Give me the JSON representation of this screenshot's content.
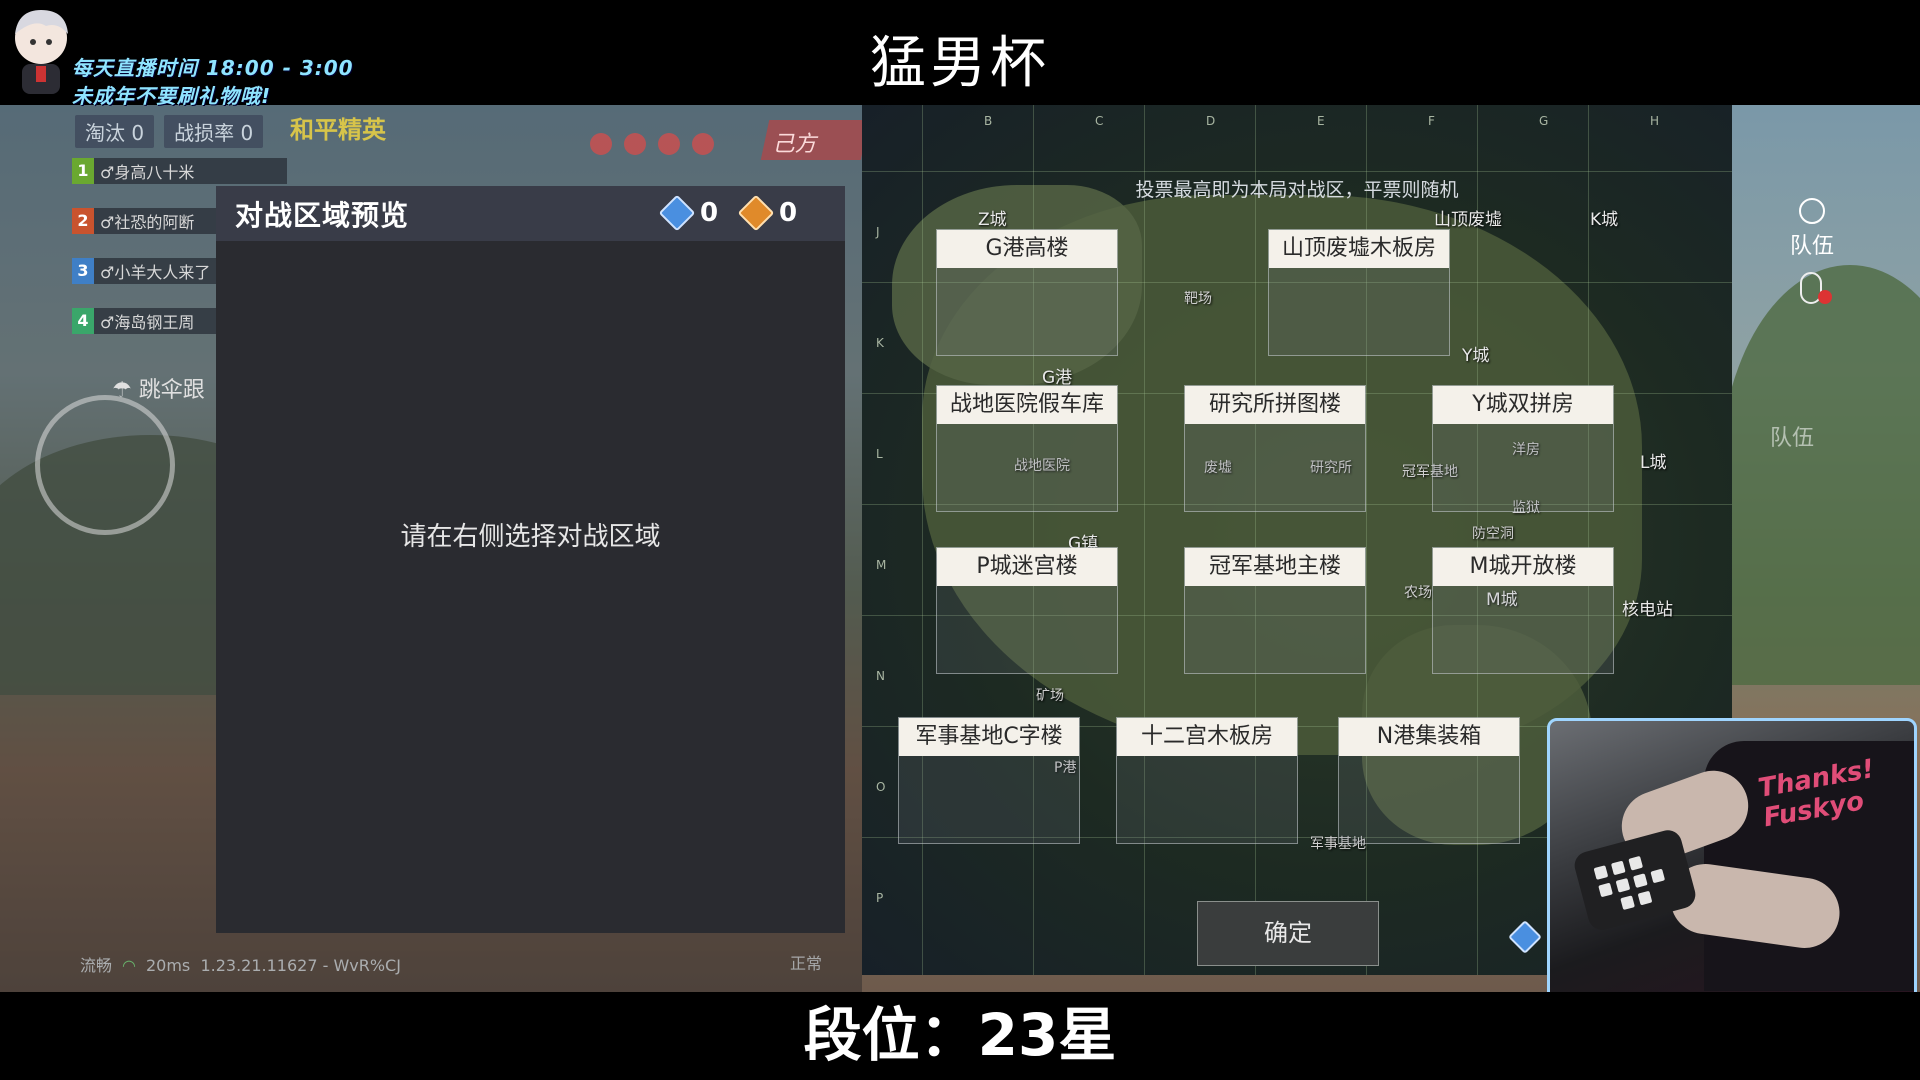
{
  "stream": {
    "title": "猛男杯",
    "schedule_line": "每天直播时间 18:00 - 3:00",
    "notice_line": "未成年不要刷礼物哦!",
    "rank_text": "段位：23星"
  },
  "hud": {
    "eliminations_label": "淘汰",
    "eliminations_value": "0",
    "loss_rate_label": "战损率",
    "loss_rate_value": "0",
    "mode_label": "和平精英",
    "team_label": "己方",
    "squad": [
      {
        "num": "1",
        "name": "♂身高八十米"
      },
      {
        "num": "2",
        "name": "♂社恐的阿断"
      },
      {
        "num": "3",
        "name": "♂小羊大人来了"
      },
      {
        "num": "4",
        "name": "♂海岛钢王周"
      }
    ],
    "parachute_label": "跳伞跟",
    "network_status": "流畅",
    "ping": "20ms",
    "version": "1.23.21.11627 - WvR%CJ",
    "normal_label": "正常"
  },
  "zone_panel": {
    "title": "对战区域预览",
    "blue_votes": "0",
    "orange_votes": "0",
    "empty_prompt": "请在右侧选择对战区域"
  },
  "map": {
    "hint": "投票最高即为本局对战区，平票则随机",
    "column_letters": [
      "B",
      "C",
      "D",
      "E",
      "F",
      "G",
      "H"
    ],
    "row_letters": [
      "J",
      "K",
      "L",
      "M",
      "N",
      "O",
      "P"
    ],
    "places": {
      "z_city": "Z城",
      "hilltop_ruins": "山顶废墟",
      "k_city": "K城",
      "shooting_range": "靶场",
      "y_city": "Y城",
      "g_port": "G港",
      "field_hospital": "战地医院",
      "ruins": "废墟",
      "research_institute": "研究所",
      "champion_base": "冠军基地",
      "villa": "洋房",
      "l_city": "L城",
      "prison": "监狱",
      "air_raid_shelter": "防空洞",
      "g_town": "G镇",
      "farm": "农场",
      "m_city": "M城",
      "nuclear_plant": "核电站",
      "mine": "矿场",
      "p_port": "P港",
      "military_base": "军事基地"
    },
    "zones": [
      "G港高楼",
      "山顶废墟木板房",
      "战地医院假车库",
      "研究所拼图楼",
      "Y城双拼房",
      "P城迷宫楼",
      "冠军基地主楼",
      "M城开放楼",
      "军事基地C字楼",
      "十二宫木板房",
      "N港集装箱"
    ],
    "confirm_label": "确定"
  },
  "right_hud": {
    "team_label": "队伍"
  },
  "webcam": {
    "shirt_text": "Thanks! Fuskyo"
  },
  "colors": {
    "panel_bg": "#2a2b30",
    "panel_header": "#393c48",
    "blue_vote": "#4a8fe0",
    "orange_vote": "#e08a2a",
    "zone_label_bg": "#f4f1ea",
    "notice_text": "#8fe4ff",
    "webcam_border": "#9fd5ff"
  },
  "icons": [
    "avatar-icon",
    "blue-diamond-icon",
    "orange-diamond-icon",
    "parachute-icon",
    "mic-icon",
    "team-icon",
    "signal-icon"
  ]
}
